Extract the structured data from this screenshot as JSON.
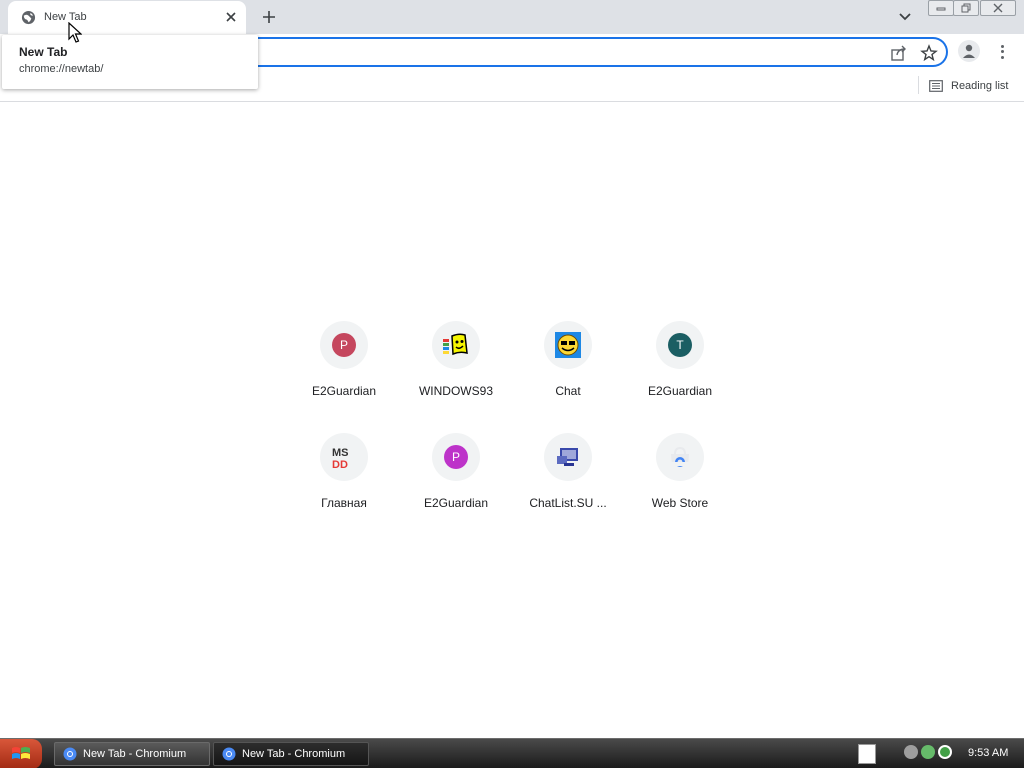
{
  "browser": {
    "tab": {
      "title": "New Tab"
    },
    "hover_card": {
      "title": "New Tab",
      "url": "chrome://newtab/"
    },
    "bookmarks": {
      "reading_list_label": "Reading list"
    }
  },
  "shortcuts": [
    {
      "label": "E2Guardian",
      "icon": "letter-p-icon",
      "letter": "P",
      "color": "#c5475e"
    },
    {
      "label": "WINDOWS93",
      "icon": "windows93-icon"
    },
    {
      "label": "Chat",
      "icon": "chat-smiley-icon"
    },
    {
      "label": "E2Guardian",
      "icon": "letter-t-icon",
      "letter": "T",
      "color": "#1b5e63"
    },
    {
      "label": "Главная",
      "icon": "msdd-icon",
      "glyph": "MS\nDD"
    },
    {
      "label": "E2Guardian",
      "icon": "letter-p-icon",
      "letter": "P",
      "color": "#bd33c9"
    },
    {
      "label": "ChatList.SU ...",
      "icon": "chatlist-icon"
    },
    {
      "label": "Web Store",
      "icon": "web-store-icon"
    }
  ],
  "taskbar": {
    "items": [
      {
        "label": "New Tab - Chromium"
      },
      {
        "label": "New Tab - Chromium"
      }
    ],
    "clock": "9:53 AM"
  },
  "colors": {
    "accent": "#1a73e8",
    "tabstrip": "#dee1e6"
  }
}
